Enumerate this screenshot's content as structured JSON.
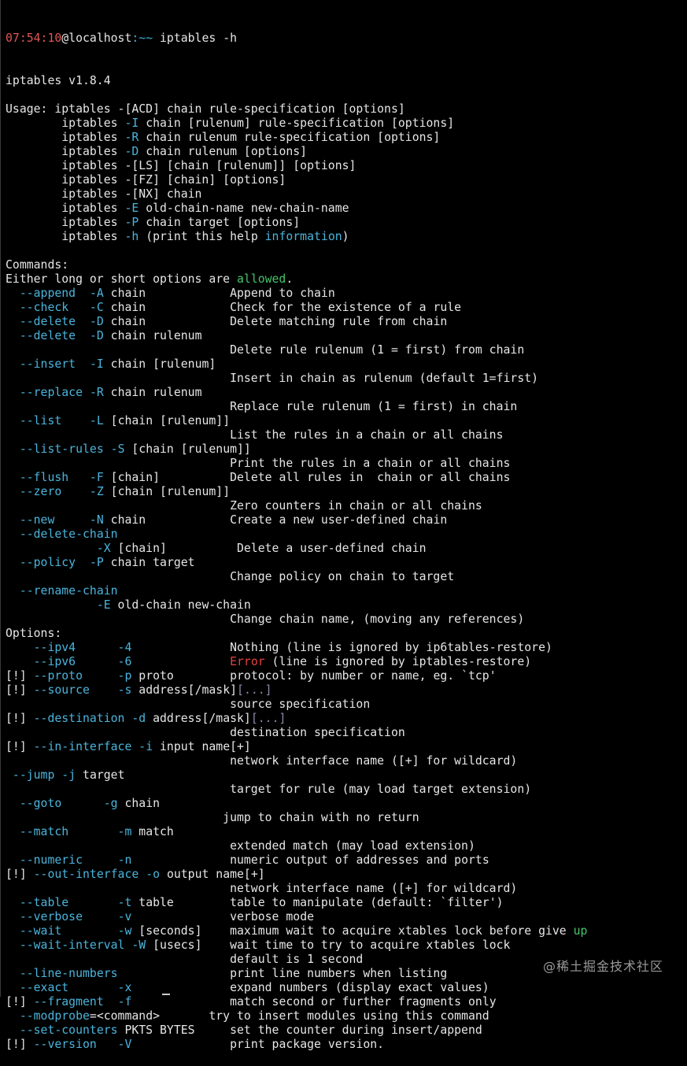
{
  "prompt": {
    "time": "07:54:10",
    "host": "@localhost",
    "path": ":~~",
    "command": " iptables -h"
  },
  "lines": [
    [
      {
        "t": "iptables v1.8.4"
      }
    ],
    [
      {
        "t": ""
      }
    ],
    [
      {
        "t": "Usage: iptables -[ACD] chain rule-specification [options]"
      }
    ],
    [
      {
        "t": "        iptables "
      },
      {
        "t": "-I",
        "c": "opt"
      },
      {
        "t": " chain [rulenum] rule-specification [options]"
      }
    ],
    [
      {
        "t": "        iptables "
      },
      {
        "t": "-R",
        "c": "opt"
      },
      {
        "t": " chain rulenum rule-specification [options]"
      }
    ],
    [
      {
        "t": "        iptables "
      },
      {
        "t": "-D",
        "c": "opt"
      },
      {
        "t": " chain rulenum [options]"
      }
    ],
    [
      {
        "t": "        iptables -[LS] [chain [rulenum]] [options]"
      }
    ],
    [
      {
        "t": "        iptables -[FZ] [chain] [options]"
      }
    ],
    [
      {
        "t": "        iptables -[NX] chain"
      }
    ],
    [
      {
        "t": "        iptables "
      },
      {
        "t": "-E",
        "c": "opt"
      },
      {
        "t": " old-chain-name new-chain-name"
      }
    ],
    [
      {
        "t": "        iptables "
      },
      {
        "t": "-P",
        "c": "opt"
      },
      {
        "t": " chain target [options]"
      }
    ],
    [
      {
        "t": "        iptables "
      },
      {
        "t": "-h",
        "c": "opt"
      },
      {
        "t": " (print this help "
      },
      {
        "t": "information",
        "c": "opt"
      },
      {
        "t": ")"
      }
    ],
    [
      {
        "t": ""
      }
    ],
    [
      {
        "t": "Commands:"
      }
    ],
    [
      {
        "t": "Either long or short options are "
      },
      {
        "t": "allowed",
        "c": "green"
      },
      {
        "t": "."
      }
    ],
    [
      {
        "t": "  "
      },
      {
        "t": "--append",
        "c": "opt"
      },
      {
        "t": "  "
      },
      {
        "t": "-A",
        "c": "opt"
      },
      {
        "t": " chain            Append to chain"
      }
    ],
    [
      {
        "t": "  "
      },
      {
        "t": "--check",
        "c": "opt"
      },
      {
        "t": "   "
      },
      {
        "t": "-C",
        "c": "opt"
      },
      {
        "t": " chain            Check for the existence of a rule"
      }
    ],
    [
      {
        "t": "  "
      },
      {
        "t": "--delete",
        "c": "opt"
      },
      {
        "t": "  "
      },
      {
        "t": "-D",
        "c": "opt"
      },
      {
        "t": " chain            Delete matching rule from chain"
      }
    ],
    [
      {
        "t": "  "
      },
      {
        "t": "--delete",
        "c": "opt"
      },
      {
        "t": "  "
      },
      {
        "t": "-D",
        "c": "opt"
      },
      {
        "t": " chain rulenum"
      }
    ],
    [
      {
        "t": "                                Delete rule rulenum (1 = first) from chain"
      }
    ],
    [
      {
        "t": "  "
      },
      {
        "t": "--insert",
        "c": "opt"
      },
      {
        "t": "  "
      },
      {
        "t": "-I",
        "c": "opt"
      },
      {
        "t": " chain [rulenum]"
      }
    ],
    [
      {
        "t": "                                Insert in chain as rulenum (default 1=first)"
      }
    ],
    [
      {
        "t": "  "
      },
      {
        "t": "--replace",
        "c": "opt"
      },
      {
        "t": " "
      },
      {
        "t": "-R",
        "c": "opt"
      },
      {
        "t": " chain rulenum"
      }
    ],
    [
      {
        "t": "                                Replace rule rulenum (1 = first) in chain"
      }
    ],
    [
      {
        "t": "  "
      },
      {
        "t": "--list",
        "c": "opt"
      },
      {
        "t": "    "
      },
      {
        "t": "-L",
        "c": "opt"
      },
      {
        "t": " [chain [rulenum]]"
      }
    ],
    [
      {
        "t": "                                List the rules in a chain or all chains"
      }
    ],
    [
      {
        "t": "  "
      },
      {
        "t": "--list-rules",
        "c": "opt"
      },
      {
        "t": " "
      },
      {
        "t": "-S",
        "c": "opt"
      },
      {
        "t": " [chain [rulenum]]"
      }
    ],
    [
      {
        "t": "                                Print the rules in a chain or all chains"
      }
    ],
    [
      {
        "t": "  "
      },
      {
        "t": "--flush",
        "c": "opt"
      },
      {
        "t": "   "
      },
      {
        "t": "-F",
        "c": "opt"
      },
      {
        "t": " [chain]          Delete all rules in  chain or all chains"
      }
    ],
    [
      {
        "t": "  "
      },
      {
        "t": "--zero",
        "c": "opt"
      },
      {
        "t": "    "
      },
      {
        "t": "-Z",
        "c": "opt"
      },
      {
        "t": " [chain [rulenum]]"
      }
    ],
    [
      {
        "t": "                                Zero counters in chain or all chains"
      }
    ],
    [
      {
        "t": "  "
      },
      {
        "t": "--new",
        "c": "opt"
      },
      {
        "t": "     "
      },
      {
        "t": "-N",
        "c": "opt"
      },
      {
        "t": " chain            Create a new user-defined chain"
      }
    ],
    [
      {
        "t": "  "
      },
      {
        "t": "--delete-chain",
        "c": "opt"
      }
    ],
    [
      {
        "t": "             "
      },
      {
        "t": "-X",
        "c": "opt"
      },
      {
        "t": " [chain]          Delete a user-defined chain"
      }
    ],
    [
      {
        "t": "  "
      },
      {
        "t": "--policy",
        "c": "opt"
      },
      {
        "t": "  "
      },
      {
        "t": "-P",
        "c": "opt"
      },
      {
        "t": " chain target"
      }
    ],
    [
      {
        "t": "                                Change policy on chain to target"
      }
    ],
    [
      {
        "t": "  "
      },
      {
        "t": "--rename-chain",
        "c": "opt"
      }
    ],
    [
      {
        "t": "             "
      },
      {
        "t": "-E",
        "c": "opt"
      },
      {
        "t": " old-chain new-chain"
      }
    ],
    [
      {
        "t": "                                Change chain name, (moving any references)"
      }
    ],
    [
      {
        "t": "Options:"
      }
    ],
    [
      {
        "t": "    "
      },
      {
        "t": "--ipv4",
        "c": "opt"
      },
      {
        "t": "      "
      },
      {
        "t": "-4",
        "c": "opt"
      },
      {
        "t": "              Nothing (line is ignored by ip6tables-restore)"
      }
    ],
    [
      {
        "t": "    "
      },
      {
        "t": "--ipv6",
        "c": "opt"
      },
      {
        "t": "      "
      },
      {
        "t": "-6",
        "c": "opt"
      },
      {
        "t": "              "
      },
      {
        "t": "Error",
        "c": "red"
      },
      {
        "t": " (line is ignored by iptables-restore)"
      }
    ],
    [
      {
        "t": "[!] "
      },
      {
        "t": "--proto",
        "c": "opt"
      },
      {
        "t": "     "
      },
      {
        "t": "-p",
        "c": "opt"
      },
      {
        "t": " proto        protocol: by number or name, eg. `tcp'"
      }
    ],
    [
      {
        "t": "[!] "
      },
      {
        "t": "--source",
        "c": "opt"
      },
      {
        "t": "    "
      },
      {
        "t": "-s",
        "c": "opt"
      },
      {
        "t": " address[/mask]"
      },
      {
        "t": "[...]",
        "c": "dim"
      }
    ],
    [
      {
        "t": "                                source specification"
      }
    ],
    [
      {
        "t": "[!] "
      },
      {
        "t": "--destination",
        "c": "opt"
      },
      {
        "t": " "
      },
      {
        "t": "-d",
        "c": "opt"
      },
      {
        "t": " address[/mask]"
      },
      {
        "t": "[...]",
        "c": "dim"
      }
    ],
    [
      {
        "t": "                                destination specification"
      }
    ],
    [
      {
        "t": "[!] "
      },
      {
        "t": "--in-interface",
        "c": "opt"
      },
      {
        "t": " "
      },
      {
        "t": "-i",
        "c": "opt"
      },
      {
        "t": " input name[+]"
      }
    ],
    [
      {
        "t": "                                network interface name ([+] for wildcard)"
      }
    ],
    [
      {
        "t": " "
      },
      {
        "t": "--jump",
        "c": "opt"
      },
      {
        "t": " "
      },
      {
        "t": "-j",
        "c": "opt"
      },
      {
        "t": " target"
      }
    ],
    [
      {
        "t": "                                target for rule (may load target extension)"
      }
    ],
    [
      {
        "t": "  "
      },
      {
        "t": "--goto",
        "c": "opt"
      },
      {
        "t": "      "
      },
      {
        "t": "-g",
        "c": "opt"
      },
      {
        "t": " chain"
      }
    ],
    [
      {
        "t": "                               jump to chain with no return"
      }
    ],
    [
      {
        "t": "  "
      },
      {
        "t": "--match",
        "c": "opt"
      },
      {
        "t": "       "
      },
      {
        "t": "-m",
        "c": "opt"
      },
      {
        "t": " match"
      }
    ],
    [
      {
        "t": "                                extended match (may load extension)"
      }
    ],
    [
      {
        "t": "  "
      },
      {
        "t": "--numeric",
        "c": "opt"
      },
      {
        "t": "     "
      },
      {
        "t": "-n",
        "c": "opt"
      },
      {
        "t": "              numeric output of addresses and ports"
      }
    ],
    [
      {
        "t": "[!] "
      },
      {
        "t": "--out-interface",
        "c": "opt"
      },
      {
        "t": " "
      },
      {
        "t": "-o",
        "c": "opt"
      },
      {
        "t": " output name[+]"
      }
    ],
    [
      {
        "t": "                                network interface name ([+] for wildcard)"
      }
    ],
    [
      {
        "t": "  "
      },
      {
        "t": "--table",
        "c": "opt"
      },
      {
        "t": "       "
      },
      {
        "t": "-t",
        "c": "opt"
      },
      {
        "t": " table        table to manipulate (default: `filter')"
      }
    ],
    [
      {
        "t": "  "
      },
      {
        "t": "--verbose",
        "c": "opt"
      },
      {
        "t": "     "
      },
      {
        "t": "-v",
        "c": "opt"
      },
      {
        "t": "              verbose mode"
      }
    ],
    [
      {
        "t": "  "
      },
      {
        "t": "--wait",
        "c": "opt"
      },
      {
        "t": "        "
      },
      {
        "t": "-w",
        "c": "opt"
      },
      {
        "t": " [seconds]    maximum wait to acquire xtables lock before give "
      },
      {
        "t": "up",
        "c": "green"
      }
    ],
    [
      {
        "t": "  "
      },
      {
        "t": "--wait-interval",
        "c": "opt"
      },
      {
        "t": " "
      },
      {
        "t": "-W",
        "c": "opt"
      },
      {
        "t": " [usecs]    wait time to try to acquire xtables lock"
      }
    ],
    [
      {
        "t": "                                default is 1 second"
      }
    ],
    [
      {
        "t": "  "
      },
      {
        "t": "--line-numbers",
        "c": "opt"
      },
      {
        "t": "                print line numbers when listing"
      }
    ],
    [
      {
        "t": "  "
      },
      {
        "t": "--exact",
        "c": "opt"
      },
      {
        "t": "       "
      },
      {
        "t": "-x",
        "c": "opt"
      },
      {
        "t": "              expand numbers (display exact values)"
      }
    ],
    [
      {
        "t": "[!] "
      },
      {
        "t": "--fragment",
        "c": "opt"
      },
      {
        "t": "  "
      },
      {
        "t": "-f",
        "c": "opt"
      },
      {
        "t": "              match second or further fragments only"
      }
    ],
    [
      {
        "t": "  "
      },
      {
        "t": "--modprobe",
        "c": "opt"
      },
      {
        "t": "=<command>       try to insert modules using this command"
      }
    ],
    [
      {
        "t": "  "
      },
      {
        "t": "--set-counters",
        "c": "opt"
      },
      {
        "t": " PKTS BYTES     set the counter during insert/append"
      }
    ],
    [
      {
        "t": "[!] "
      },
      {
        "t": "--version",
        "c": "opt"
      },
      {
        "t": "   "
      },
      {
        "t": "-V",
        "c": "opt"
      },
      {
        "t": "              print package version."
      }
    ]
  ],
  "watermark": "@稀土掘金技术社区"
}
